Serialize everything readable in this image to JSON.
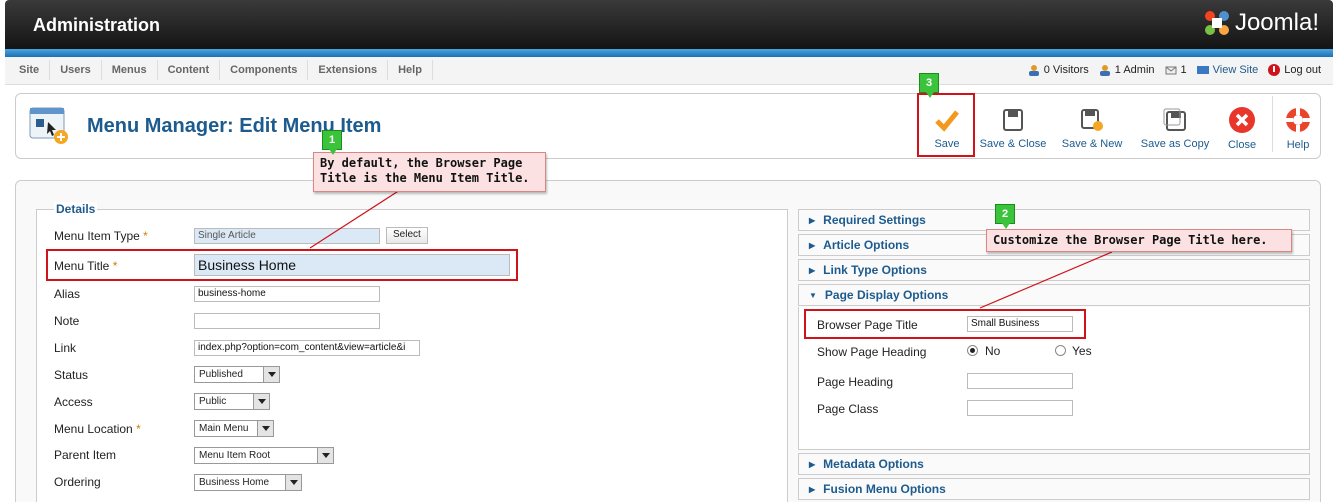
{
  "header": {
    "title": "Administration",
    "logo_text": "Joomla!"
  },
  "menubar": {
    "items": [
      "Site",
      "Users",
      "Menus",
      "Content",
      "Components",
      "Extensions",
      "Help"
    ]
  },
  "status": {
    "visitors": "0 Visitors",
    "admins": "1 Admin",
    "messages": "1",
    "view_site": "View Site",
    "logout": "Log out"
  },
  "toolbar": {
    "page_title": "Menu Manager: Edit Menu Item",
    "buttons": {
      "save": "Save",
      "save_close": "Save & Close",
      "save_new": "Save & New",
      "save_copy": "Save as Copy",
      "close": "Close",
      "help": "Help"
    }
  },
  "details": {
    "legend": "Details",
    "menu_item_type": {
      "label": "Menu Item Type",
      "value": "Single Article",
      "button": "Select"
    },
    "menu_title": {
      "label": "Menu Title",
      "value": "Business Home"
    },
    "alias": {
      "label": "Alias",
      "value": "business-home"
    },
    "note": {
      "label": "Note",
      "value": ""
    },
    "link": {
      "label": "Link",
      "value": "index.php?option=com_content&view=article&i"
    },
    "status": {
      "label": "Status",
      "value": "Published"
    },
    "access": {
      "label": "Access",
      "value": "Public"
    },
    "menu_location": {
      "label": "Menu Location",
      "value": "Main Menu"
    },
    "parent_item": {
      "label": "Parent Item",
      "value": "Menu Item Root"
    },
    "ordering": {
      "label": "Ordering",
      "value": "Business Home"
    },
    "required_mark": "*"
  },
  "panes": {
    "required": "Required Settings",
    "article": "Article Options",
    "link_type": "Link Type Options",
    "page_display": "Page Display Options",
    "metadata": "Metadata Options",
    "fusion": "Fusion Menu Options"
  },
  "page_display": {
    "browser_title": {
      "label": "Browser Page Title",
      "value": "Small Business"
    },
    "show_heading": {
      "label": "Show Page Heading",
      "no": "No",
      "yes": "Yes",
      "selected": "No"
    },
    "page_heading": {
      "label": "Page Heading",
      "value": ""
    },
    "page_class": {
      "label": "Page Class",
      "value": ""
    }
  },
  "annotations": {
    "callout1": "By default, the Browser Page\nTitle is the Menu Item Title.",
    "callout2": "Customize the Browser Page Title here.",
    "badge1": "1",
    "badge2": "2",
    "badge3": "3"
  },
  "colors": {
    "accent": "#1d5b8e",
    "highlight": "#d0131b",
    "callout_bg": "#fbe1e1",
    "badge": "#3bc43b"
  }
}
